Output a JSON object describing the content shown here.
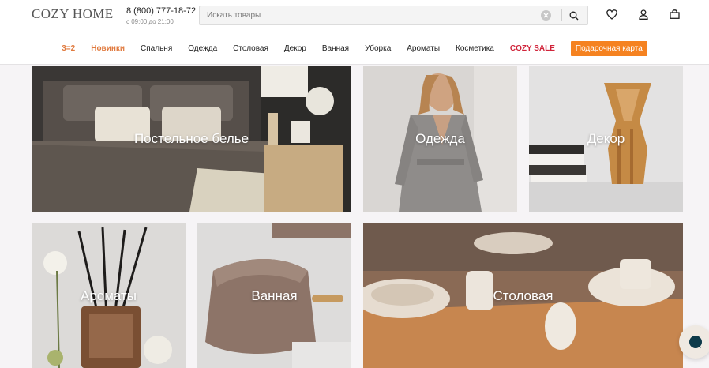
{
  "header": {
    "logo": "COZY HOME",
    "phone": "8 (800) 777-18-72",
    "hours": "с 09:00 до 21:00",
    "search": {
      "placeholder": "Искать товары",
      "value": ""
    },
    "icons": [
      "search-icon",
      "clear-icon",
      "heart-icon",
      "user-icon",
      "bag-icon"
    ]
  },
  "nav": {
    "items": [
      "3=2",
      "Новинки",
      "Спальня",
      "Одежда",
      "Столовая",
      "Декор",
      "Ванная",
      "Уборка",
      "Ароматы",
      "Косметика",
      "COZY SALE",
      "Подарочная карта"
    ]
  },
  "tiles": [
    {
      "label": "Постельное белье"
    },
    {
      "label": "Одежда"
    },
    {
      "label": "Декор"
    },
    {
      "label": "Ароматы"
    },
    {
      "label": "Ванная"
    },
    {
      "label": "Столовая"
    }
  ],
  "colors": {
    "accent": "#e07a3e",
    "sale": "#d0243a",
    "card_button": "#f58220",
    "background": "#f6f4f6"
  }
}
